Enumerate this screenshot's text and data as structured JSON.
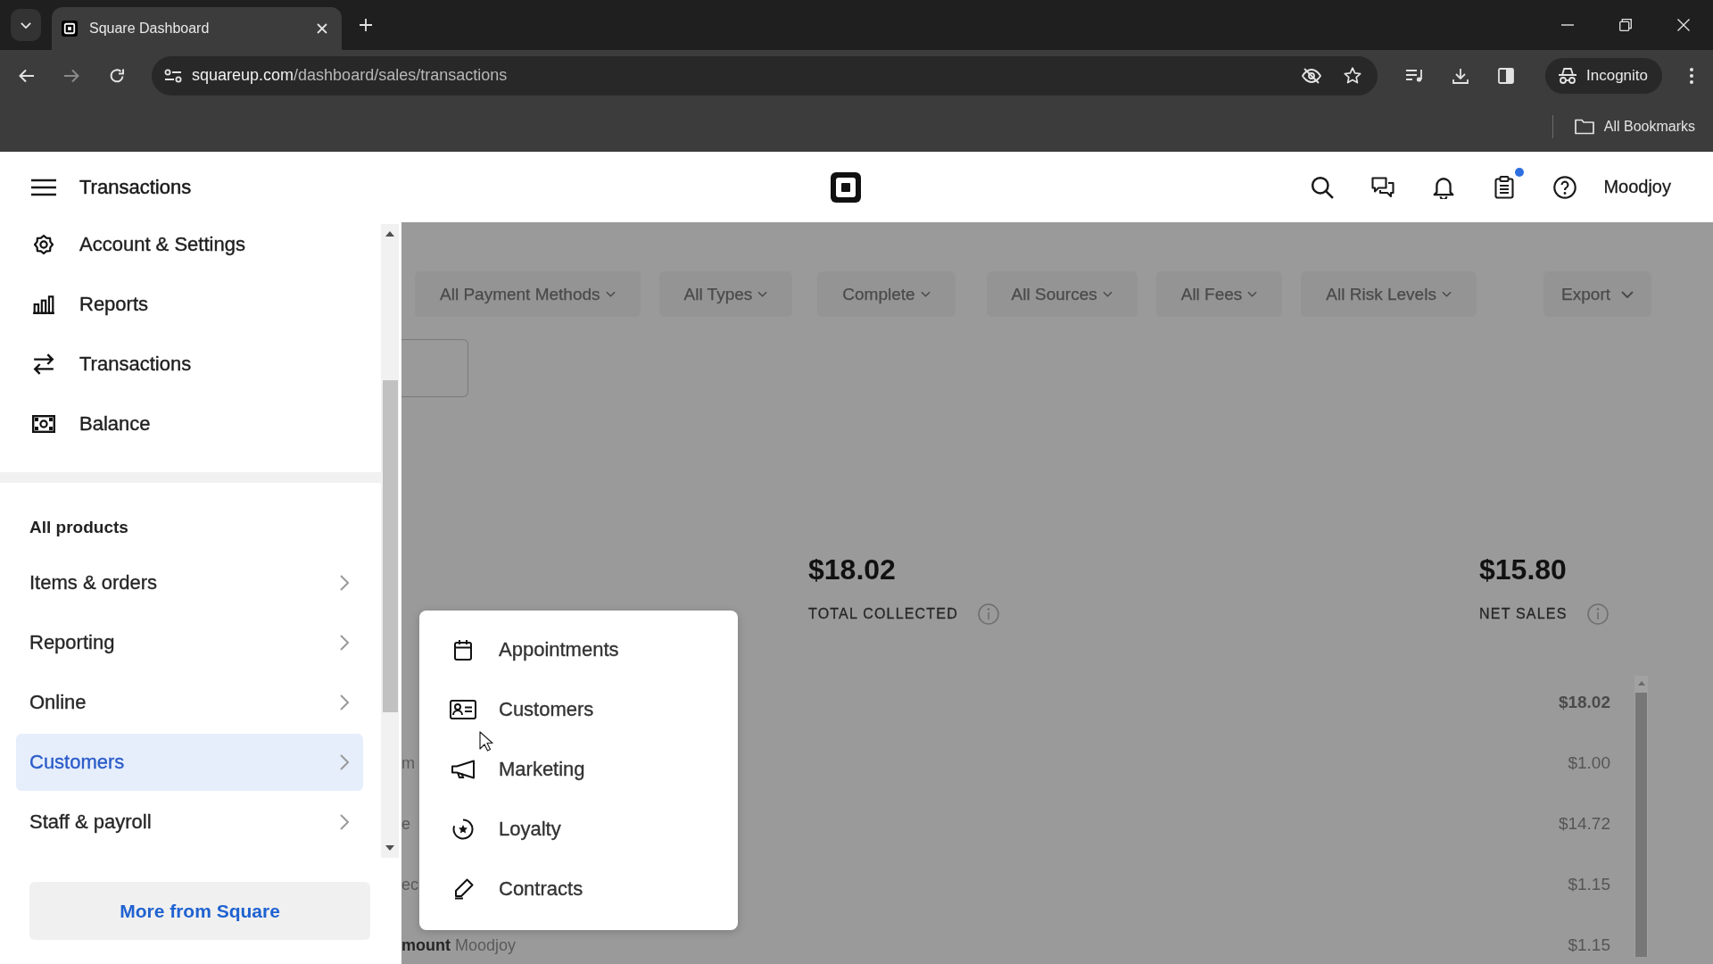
{
  "browser": {
    "tabs": [
      {
        "title": "Square Dashboard",
        "selected": true
      }
    ],
    "address": {
      "host": "squareup.com",
      "path": "/dashboard/sales/transactions"
    },
    "profile": "Incognito",
    "bookmarks": [
      {
        "label": "All Bookmarks"
      }
    ]
  },
  "header": {
    "title": "Transactions",
    "notification_dot": true,
    "account": "Moodjoy"
  },
  "sidebar": {
    "nav_items": [
      {
        "label": "Account & Settings"
      },
      {
        "label": "Reports"
      },
      {
        "label": "Transactions"
      },
      {
        "label": "Balance"
      }
    ],
    "section_title": "All products",
    "products": [
      {
        "label": "Items & orders",
        "selected": false
      },
      {
        "label": "Reporting",
        "selected": false
      },
      {
        "label": "Online",
        "selected": false
      },
      {
        "label": "Customers",
        "selected": true
      },
      {
        "label": "Staff & payroll",
        "selected": false
      }
    ],
    "more_button": "More from Square"
  },
  "main": {
    "filters": [
      {
        "label": "All Payment Methods"
      },
      {
        "label": "All Types"
      },
      {
        "label": "Complete"
      },
      {
        "label": "All Sources"
      },
      {
        "label": "All Fees"
      },
      {
        "label": "All Risk Levels"
      }
    ],
    "export_button": "Export",
    "stats": [
      {
        "value": "$18.02",
        "label": "TOTAL COLLECTED"
      },
      {
        "value": "$15.80",
        "label": "NET SALES"
      }
    ],
    "rows": [
      {
        "amount": "$18.02",
        "bold": true
      },
      {
        "label": "m",
        "amount": "$1.00",
        "bold": false
      },
      {
        "label": "e",
        "amount": "$14.72",
        "bold": false
      },
      {
        "label": "ec",
        "amount": "$1.15",
        "bold": false
      },
      {
        "label": "**mount** Moodjoy",
        "amount": "$1.15",
        "bold": false
      }
    ]
  },
  "menu": {
    "items": [
      {
        "label": "Appointments"
      },
      {
        "label": "Customers"
      },
      {
        "label": "Marketing"
      },
      {
        "label": "Loyalty"
      },
      {
        "label": "Contracts"
      }
    ]
  }
}
